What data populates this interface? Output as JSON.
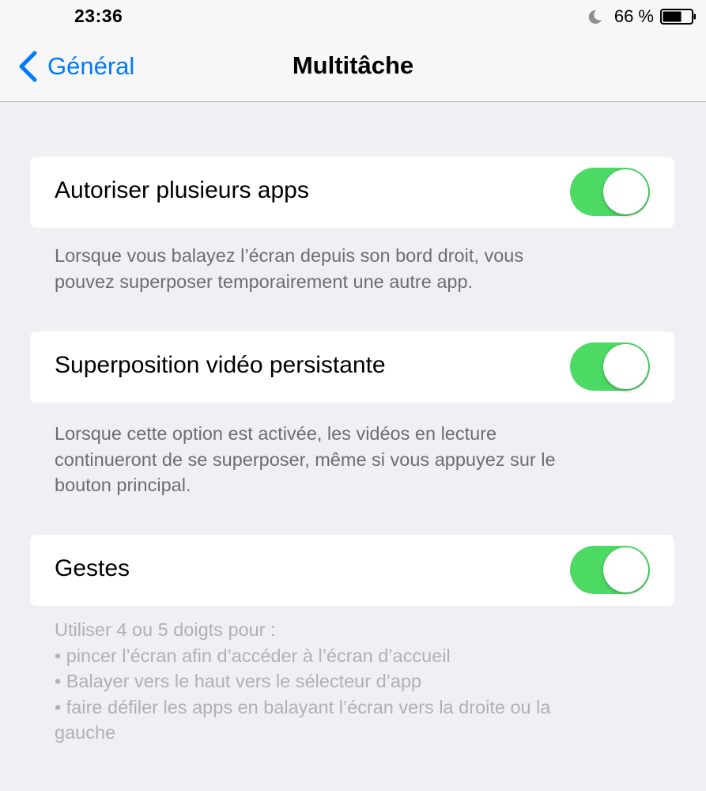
{
  "status_bar": {
    "time": "23:36",
    "battery_percent": "66 %",
    "battery_level": 0.66,
    "icons": [
      "moon-icon",
      "battery-icon"
    ]
  },
  "nav": {
    "back_label": "Général",
    "title": "Multitâche"
  },
  "colors": {
    "accent": "#007aff",
    "toggle_on": "#4cd964",
    "background": "#efeff4"
  },
  "settings": [
    {
      "label": "Autoriser plusieurs apps",
      "enabled": true,
      "footer": [
        "Lorsque vous balayez l’écran depuis son bord droit, vous",
        "pouvez superposer temporairement une autre app."
      ]
    },
    {
      "label": "Superposition vidéo persistante",
      "enabled": true,
      "footer": [
        "Lorsque cette option est activée, les vidéos en lecture",
        "continueront de se superposer, même si vous appuyez sur le",
        "bouton principal."
      ]
    },
    {
      "label": "Gestes",
      "enabled": true,
      "footer": [
        "Utiliser 4 ou 5 doigts pour :",
        "• pincer l’écran afin d’accéder à l’écran d’accueil",
        "• Balayer vers le haut vers le sélecteur d’app",
        "• faire défiler les apps en balayant l’écran vers la droite ou la",
        "gauche"
      ]
    }
  ]
}
